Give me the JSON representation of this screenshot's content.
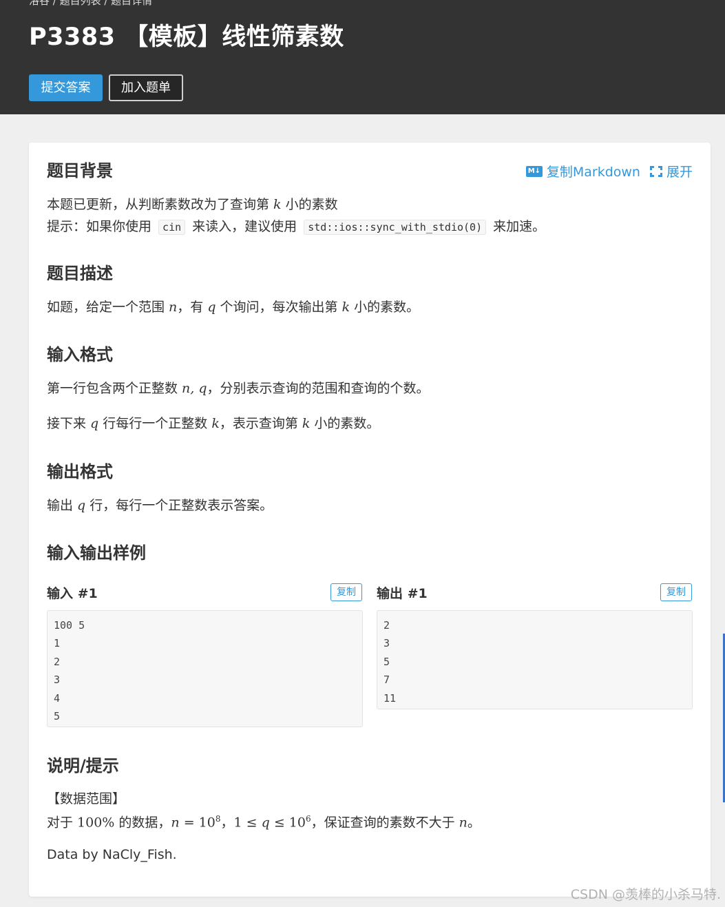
{
  "header": {
    "breadcrumb": "洛谷 / 题目列表 / 题目详情",
    "title": "P3383 【模板】线性筛素数",
    "submit_label": "提交答案",
    "add_label": "加入题单"
  },
  "toolbar": {
    "md_icon_text": "M↓",
    "copy_markdown": "复制Markdown",
    "expand": "展开"
  },
  "sections": {
    "background": {
      "title": "题目背景",
      "line1_a": "本题已更新，从判断素数改为了查询第 ",
      "line1_k": "k",
      "line1_b": " 小的素数",
      "line2_a": "提示：如果你使用 ",
      "line2_code1": "cin",
      "line2_b": " 来读入，建议使用 ",
      "line2_code2": "std::ios::sync_with_stdio(0)",
      "line2_c": " 来加速。"
    },
    "description": {
      "title": "题目描述",
      "a": "如题，给定一个范围 ",
      "n": "n",
      "b": "，有 ",
      "q": "q",
      "c": " 个询问，每次输出第 ",
      "k": "k",
      "d": " 小的素数。"
    },
    "input_format": {
      "title": "输入格式",
      "l1_a": "第一行包含两个正整数 ",
      "l1_nq": "n, q",
      "l1_b": "，分别表示查询的范围和查询的个数。",
      "l2_a": "接下来 ",
      "l2_q": "q",
      "l2_b": " 行每行一个正整数 ",
      "l2_k": "k",
      "l2_c": "，表示查询第 ",
      "l2_k2": "k",
      "l2_d": " 小的素数。"
    },
    "output_format": {
      "title": "输出格式",
      "a": "输出 ",
      "q": "q",
      "b": " 行，每行一个正整数表示答案。"
    },
    "samples": {
      "title": "输入输出样例",
      "input_title": "输入 #1",
      "output_title": "输出 #1",
      "copy_label": "复制",
      "input_lines": [
        "100 5",
        "1",
        "2",
        "3",
        "4",
        "5"
      ],
      "output_lines": [
        "2",
        "3",
        "5",
        "7",
        "11"
      ]
    },
    "hint": {
      "title": "说明/提示",
      "range_label": "【数据范围】",
      "l_a": "对于 ",
      "l_pct": "100%",
      "l_b": " 的数据，",
      "l_n": "n",
      "l_eq": " = 10",
      "l_exp8": "8",
      "l_c": "，",
      "l_ineq_1": "1 ≤ ",
      "l_ineq_q": "q",
      "l_ineq_2": " ≤ 10",
      "l_exp6": "6",
      "l_d": "，保证查询的素数不大于 ",
      "l_n2": "n",
      "l_e": "。",
      "credit": "Data by NaCly_Fish."
    }
  },
  "watermark": "CSDN @羡棒的小杀马特."
}
